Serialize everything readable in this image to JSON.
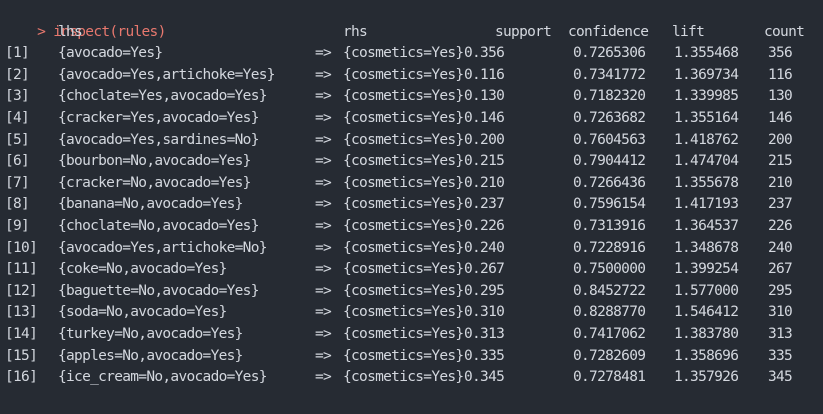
{
  "console": {
    "prompt": ">",
    "command": "inspect(rules)",
    "columns": {
      "lhs": "lhs",
      "rhs": "rhs",
      "support": "support",
      "confidence": "confidence",
      "lift": "lift",
      "count": "count"
    },
    "arrow": "=>",
    "rows": [
      {
        "idx": "[1]",
        "lhs": "{avocado=Yes}",
        "rhs": "{cosmetics=Yes}",
        "support": "0.356",
        "confidence": "0.7265306",
        "lift": "1.355468",
        "count": "356"
      },
      {
        "idx": "[2]",
        "lhs": "{avocado=Yes,artichoke=Yes}",
        "rhs": "{cosmetics=Yes}",
        "support": "0.116",
        "confidence": "0.7341772",
        "lift": "1.369734",
        "count": "116"
      },
      {
        "idx": "[3]",
        "lhs": "{choclate=Yes,avocado=Yes}",
        "rhs": "{cosmetics=Yes}",
        "support": "0.130",
        "confidence": "0.7182320",
        "lift": "1.339985",
        "count": "130"
      },
      {
        "idx": "[4]",
        "lhs": "{cracker=Yes,avocado=Yes}",
        "rhs": "{cosmetics=Yes}",
        "support": "0.146",
        "confidence": "0.7263682",
        "lift": "1.355164",
        "count": "146"
      },
      {
        "idx": "[5]",
        "lhs": "{avocado=Yes,sardines=No}",
        "rhs": "{cosmetics=Yes}",
        "support": "0.200",
        "confidence": "0.7604563",
        "lift": "1.418762",
        "count": "200"
      },
      {
        "idx": "[6]",
        "lhs": "{bourbon=No,avocado=Yes}",
        "rhs": "{cosmetics=Yes}",
        "support": "0.215",
        "confidence": "0.7904412",
        "lift": "1.474704",
        "count": "215"
      },
      {
        "idx": "[7]",
        "lhs": "{cracker=No,avocado=Yes}",
        "rhs": "{cosmetics=Yes}",
        "support": "0.210",
        "confidence": "0.7266436",
        "lift": "1.355678",
        "count": "210"
      },
      {
        "idx": "[8]",
        "lhs": "{banana=No,avocado=Yes}",
        "rhs": "{cosmetics=Yes}",
        "support": "0.237",
        "confidence": "0.7596154",
        "lift": "1.417193",
        "count": "237"
      },
      {
        "idx": "[9]",
        "lhs": "{choclate=No,avocado=Yes}",
        "rhs": "{cosmetics=Yes}",
        "support": "0.226",
        "confidence": "0.7313916",
        "lift": "1.364537",
        "count": "226"
      },
      {
        "idx": "[10]",
        "lhs": "{avocado=Yes,artichoke=No}",
        "rhs": "{cosmetics=Yes}",
        "support": "0.240",
        "confidence": "0.7228916",
        "lift": "1.348678",
        "count": "240"
      },
      {
        "idx": "[11]",
        "lhs": "{coke=No,avocado=Yes}",
        "rhs": "{cosmetics=Yes}",
        "support": "0.267",
        "confidence": "0.7500000",
        "lift": "1.399254",
        "count": "267"
      },
      {
        "idx": "[12]",
        "lhs": "{baguette=No,avocado=Yes}",
        "rhs": "{cosmetics=Yes}",
        "support": "0.295",
        "confidence": "0.8452722",
        "lift": "1.577000",
        "count": "295"
      },
      {
        "idx": "[13]",
        "lhs": "{soda=No,avocado=Yes}",
        "rhs": "{cosmetics=Yes}",
        "support": "0.310",
        "confidence": "0.8288770",
        "lift": "1.546412",
        "count": "310"
      },
      {
        "idx": "[14]",
        "lhs": "{turkey=No,avocado=Yes}",
        "rhs": "{cosmetics=Yes}",
        "support": "0.313",
        "confidence": "0.7417062",
        "lift": "1.383780",
        "count": "313"
      },
      {
        "idx": "[15]",
        "lhs": "{apples=No,avocado=Yes}",
        "rhs": "{cosmetics=Yes}",
        "support": "0.335",
        "confidence": "0.7282609",
        "lift": "1.358696",
        "count": "335"
      },
      {
        "idx": "[16]",
        "lhs": "{ice_cream=No,avocado=Yes}",
        "rhs": "{cosmetics=Yes}",
        "support": "0.345",
        "confidence": "0.7278481",
        "lift": "1.357926",
        "count": "345"
      }
    ]
  },
  "colors": {
    "background": "#262b33",
    "text": "#d3d7de",
    "prompt": "#e8786e"
  }
}
